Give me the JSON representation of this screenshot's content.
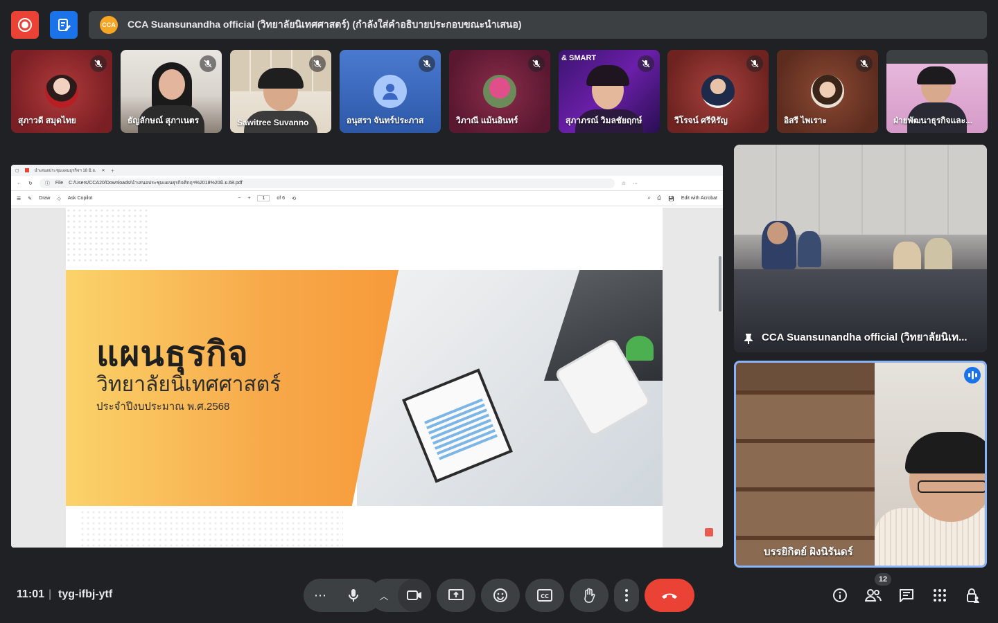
{
  "meeting": {
    "presenter_banner": "CCA Suansunandha official (วิทยาลัยนิเทศศาสตร์) (กำลังใส่คำอธิบายประกอบขณะนำเสนอ)",
    "logo_text": "CCA"
  },
  "participants": [
    {
      "name": "สุภาวดี สมุดไทย",
      "muted": true
    },
    {
      "name": "ธัญลักษณ์ สุภาเนตร",
      "muted": true
    },
    {
      "name": "Sawitree Suvanno",
      "muted": true
    },
    {
      "name": "อนุสรา จันทร์ประภาส",
      "muted": true
    },
    {
      "name": "วิภาณี แม้นอินทร์",
      "muted": true
    },
    {
      "name": "สุภาภรณ์ วิมลชัยฤกษ์",
      "muted": true,
      "banner": "& SMART"
    },
    {
      "name": "วีโรจน์ ศรีหิรัญ",
      "muted": true
    },
    {
      "name": "อิสรี ไพเราะ",
      "muted": true
    },
    {
      "name": "ฝ่ายพัฒนาธุรกิจและ...",
      "muted": false
    }
  ],
  "browser": {
    "tab_title": "นำเสนอประชุมแผนธุรกิจฯ 18 มิ.ย.",
    "file_label": "File",
    "url": "C:/Users/CCA20/Downloads/นำเสนอประชุมแผนธุรกิจศิกฤฯ%2018%20มิ.ย.68.pdf",
    "draw_label": "Draw",
    "ask_copilot": "Ask Copilot",
    "page_number": "1",
    "page_total": "of 6",
    "edit_acrobat": "Edit with Acrobat"
  },
  "slide": {
    "title": "แผนธุรกิจ",
    "subtitle": "วิทยาลัยนิเทศศาสตร์",
    "caption": "ประจำปีงบประมาณ พ.ศ.2568"
  },
  "side_tiles": {
    "pinned_name": "CCA Suansunandha official (วิทยาลัยนิเท...",
    "speaker_name": "บรรยิกิตย์ ผิงนิรันดร์"
  },
  "footer": {
    "time": "11:01",
    "separator": "|",
    "meeting_code": "tyg-ifbj-ytf",
    "people_count": "12"
  },
  "colors": {
    "background": "#202124",
    "control": "#3c4043",
    "hangup": "#ea4335",
    "accent": "#1a73e8",
    "highlight": "#8ab4f8"
  }
}
